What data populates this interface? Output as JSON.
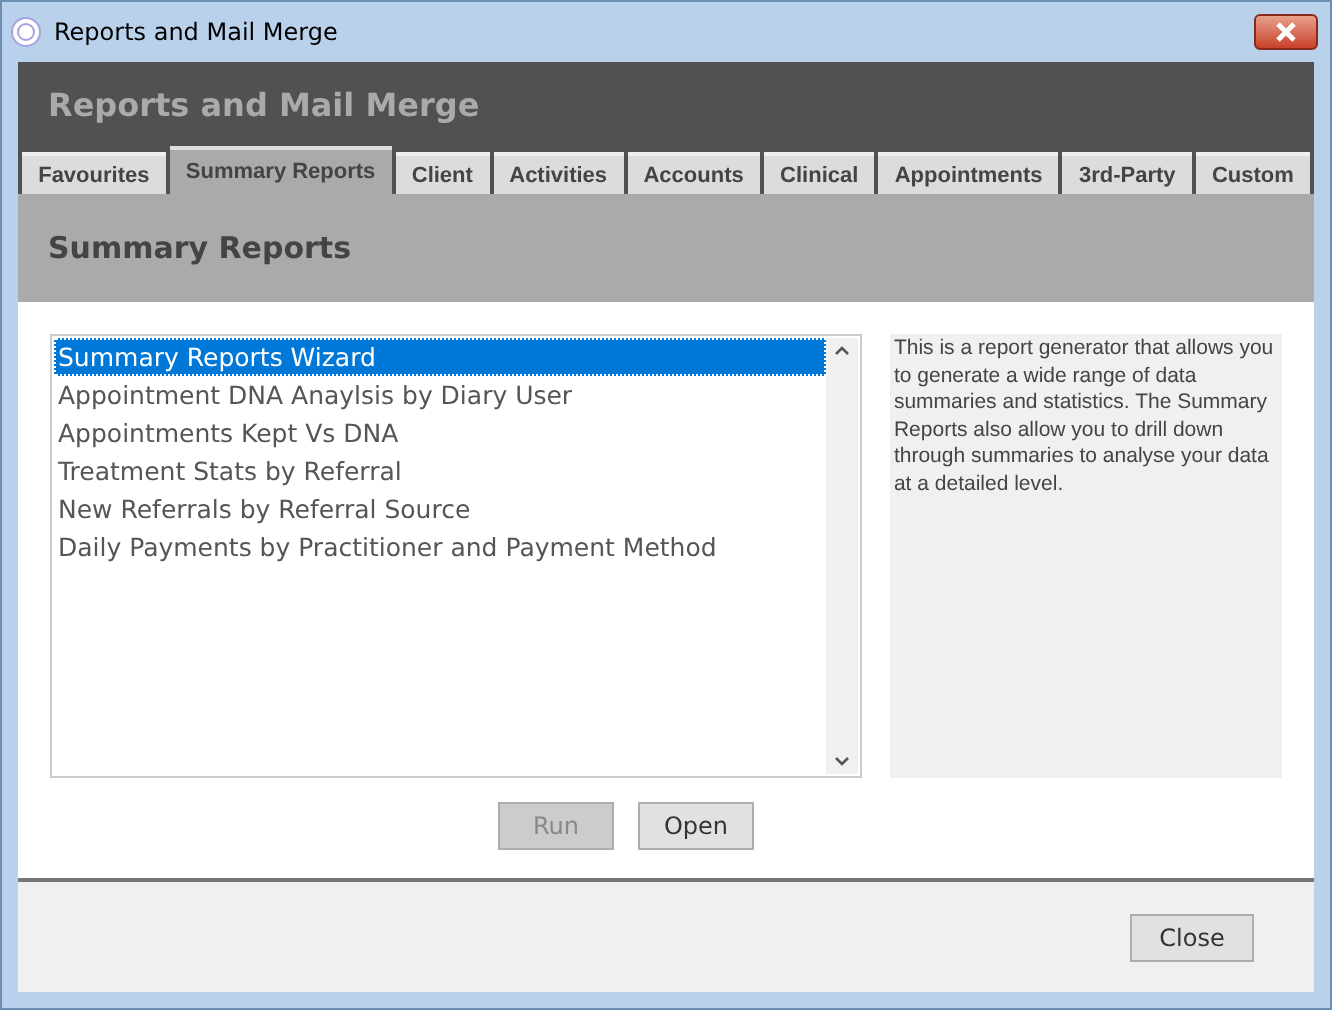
{
  "window": {
    "title": "Reports and Mail Merge"
  },
  "header": {
    "title": "Reports and Mail Merge"
  },
  "tabs": [
    {
      "label": "Favourites",
      "selected": false
    },
    {
      "label": "Summary Reports",
      "selected": true
    },
    {
      "label": "Client",
      "selected": false
    },
    {
      "label": "Activities",
      "selected": false
    },
    {
      "label": "Accounts",
      "selected": false
    },
    {
      "label": "Clinical",
      "selected": false
    },
    {
      "label": "Appointments",
      "selected": false
    },
    {
      "label": "3rd-Party",
      "selected": false
    },
    {
      "label": "Custom",
      "selected": false
    }
  ],
  "section": {
    "title": "Summary Reports"
  },
  "reports": [
    {
      "label": "Summary Reports Wizard",
      "selected": true
    },
    {
      "label": "Appointment DNA Anaylsis by Diary User",
      "selected": false
    },
    {
      "label": "Appointments Kept Vs DNA",
      "selected": false
    },
    {
      "label": "Treatment Stats by Referral",
      "selected": false
    },
    {
      "label": "New Referrals by Referral Source",
      "selected": false
    },
    {
      "label": "Daily Payments by Practitioner and Payment Method",
      "selected": false
    }
  ],
  "description": "This is a report generator that allows you to generate a wide range of data summaries and statistics. The Summary Reports also allow you to drill down through summaries to analyse your data at a detailed level.",
  "actions": [
    {
      "label": "Run",
      "disabled": true
    },
    {
      "label": "Open",
      "disabled": false
    }
  ],
  "footer_buttons": [
    {
      "label": "Close"
    }
  ]
}
